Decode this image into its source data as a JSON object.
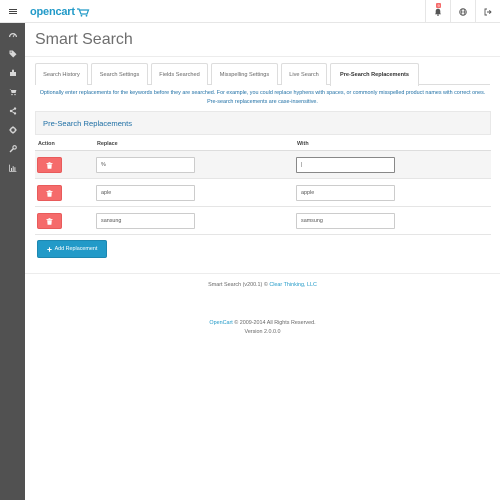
{
  "header": {
    "logo_text": "opencart",
    "notification_count": "9"
  },
  "sidebar": {
    "items": [
      {
        "icon": "dashboard-icon"
      },
      {
        "icon": "tags-icon"
      },
      {
        "icon": "puzzle-icon"
      },
      {
        "icon": "cart-icon"
      },
      {
        "icon": "share-icon"
      },
      {
        "icon": "cog-icon"
      },
      {
        "icon": "wrench-icon"
      },
      {
        "icon": "bar-chart-icon"
      }
    ]
  },
  "page": {
    "title": "Smart Search",
    "tabs": [
      {
        "label": "Search History",
        "active": false
      },
      {
        "label": "Search Settings",
        "active": false
      },
      {
        "label": "Fields Searched",
        "active": false
      },
      {
        "label": "Misspelling Settings",
        "active": false
      },
      {
        "label": "Live Search",
        "active": false
      },
      {
        "label": "Pre-Search Replacements",
        "active": true
      }
    ],
    "help_text": "Optionally enter replacements for the keywords before they are searched. For example, you could replace hyphens with spaces, or commonly misspelled product names with correct ones. Pre-search replacements are case-insensitive.",
    "panel_title": "Pre-Search Replacements",
    "columns": {
      "action": "Action",
      "replace": "Replace",
      "with": "With"
    },
    "rows": [
      {
        "replace": "%",
        "with": "|"
      },
      {
        "replace": "aple",
        "with": "apple"
      },
      {
        "replace": "sansung",
        "with": "samsung"
      }
    ],
    "add_button_label": "Add Replacement"
  },
  "footer": {
    "extension_text": "Smart Search (v200.1) ©",
    "extension_link": "Clear Thinking, LLC",
    "brand_link": "OpenCart",
    "copyright_text": "© 2009-2014 All Rights Reserved.",
    "version": "Version 2.0.0.0"
  },
  "colors": {
    "brand": "#229ac8",
    "danger": "#f56b6b",
    "sidebar": "#515151",
    "link": "#1e6fa5"
  }
}
